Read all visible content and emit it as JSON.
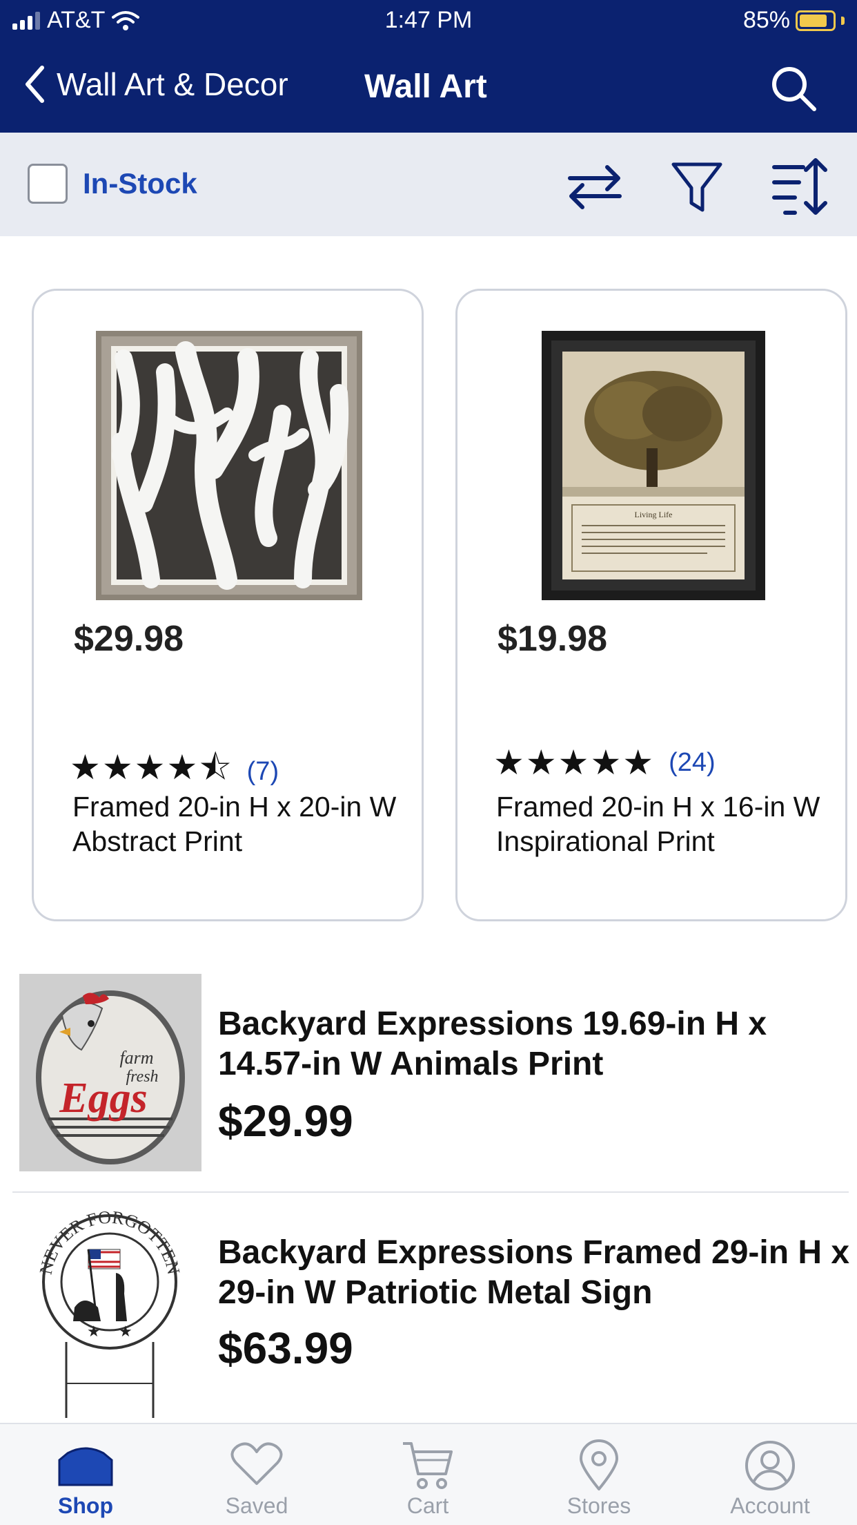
{
  "status_bar": {
    "carrier": "AT&T",
    "time": "1:47 PM",
    "battery": "85%"
  },
  "nav": {
    "back_label": "Wall Art & Decor",
    "title": "Wall Art"
  },
  "filter_bar": {
    "in_stock_label": "In-Stock",
    "in_stock_checked": false
  },
  "cards": [
    {
      "price": "$29.98",
      "rating": 4.5,
      "stars": "★★★★⯪",
      "review_count": "(7)",
      "title": "Framed 20-in H x 20-in W Abstract Print"
    },
    {
      "price": "$19.98",
      "rating": 5,
      "stars": "★★★★★",
      "review_count": "(24)",
      "title": "Framed 20-in H x 16-in W Inspirational Print",
      "image_text": {
        "heading": "Living Life"
      }
    }
  ],
  "list_items": [
    {
      "title": "Backyard Expressions 19.69-in H x 14.57-in W Animals Print",
      "price": "$29.99",
      "image_text": {
        "line1": "farm",
        "line2": "fresh",
        "line3": "Eggs"
      }
    },
    {
      "title": "Backyard Expressions Framed 29-in H x 29-in W Patriotic Metal Sign",
      "price": "$63.99",
      "image_text": {
        "ring": "NEVER FORGOTTEN"
      }
    }
  ],
  "tabs": [
    {
      "label": "Shop",
      "icon": "shop-icon",
      "active": true
    },
    {
      "label": "Saved",
      "icon": "heart-icon",
      "active": false
    },
    {
      "label": "Cart",
      "icon": "cart-icon",
      "active": false
    },
    {
      "label": "Stores",
      "icon": "location-pin-icon",
      "active": false
    },
    {
      "label": "Account",
      "icon": "account-icon",
      "active": false
    }
  ],
  "colors": {
    "header_bg": "#0b2270",
    "accent": "#1d48b4",
    "filter_bg": "#e8ebf2"
  }
}
